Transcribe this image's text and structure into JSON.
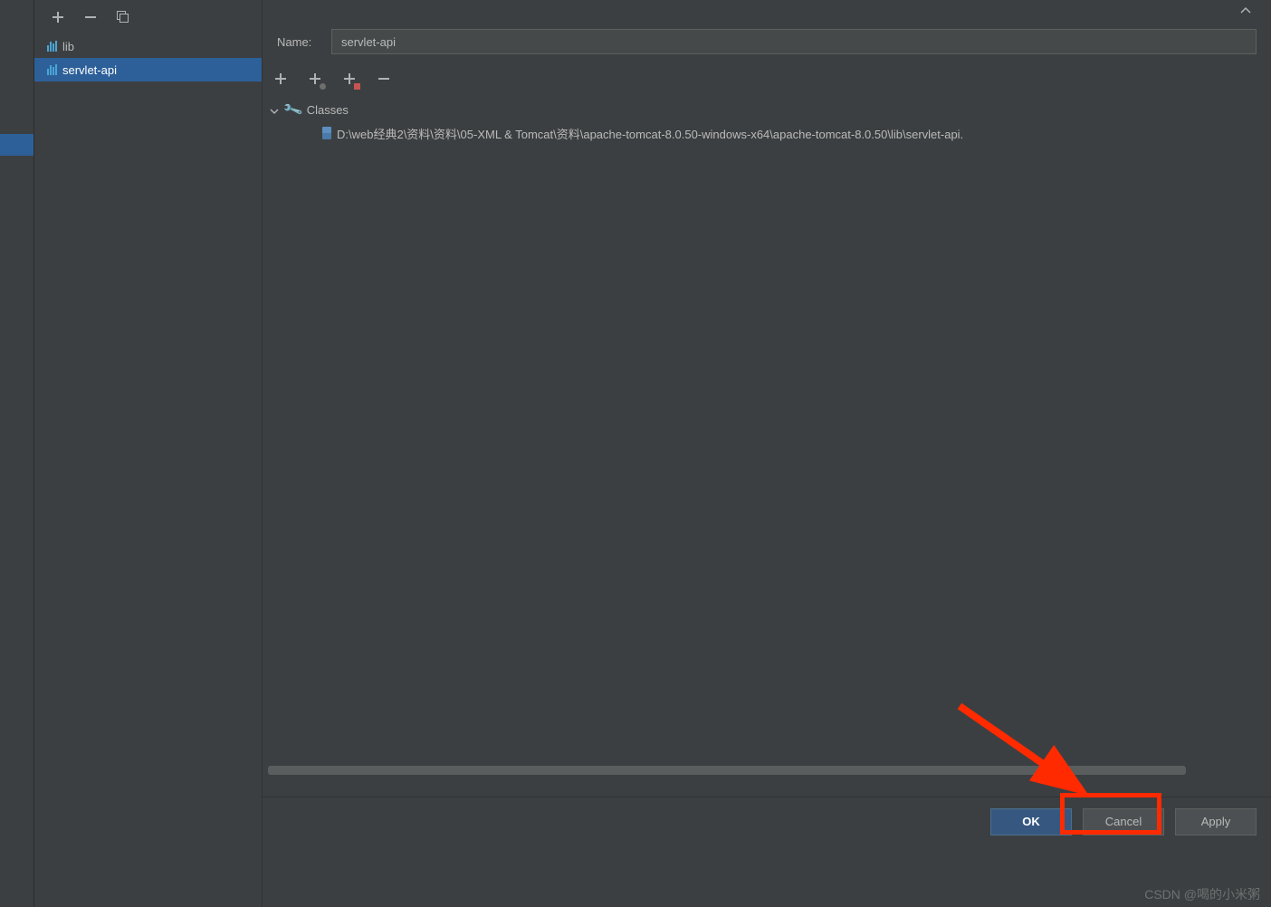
{
  "sidebar": {
    "items": [
      {
        "label": "lib"
      },
      {
        "label": "servlet-api"
      }
    ]
  },
  "main": {
    "name_label": "Name:",
    "name_value": "servlet-api",
    "tree": {
      "root_label": "Classes",
      "path": "D:\\web经典2\\资料\\资料\\05-XML & Tomcat\\资料\\apache-tomcat-8.0.50-windows-x64\\apache-tomcat-8.0.50\\lib\\servlet-api."
    }
  },
  "footer": {
    "ok_label": "OK",
    "cancel_label": "Cancel",
    "apply_label": "Apply"
  },
  "watermark": "CSDN @喝的小米粥"
}
